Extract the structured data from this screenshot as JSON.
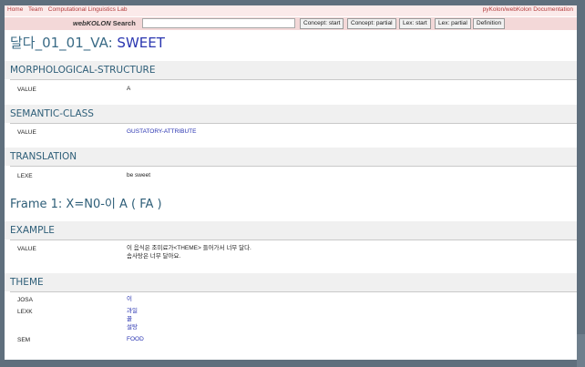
{
  "topnav": {
    "left_links": [
      "Home",
      "Team",
      "Computational Linguistics Lab"
    ],
    "right_link": "pyKolon/webKolon Documentation"
  },
  "search": {
    "label_brand": "webKOLON",
    "label_rest": "Search",
    "value": "",
    "buttons": [
      "Concept: start",
      "Concept: partial",
      "Lex: start",
      "Lex: partial",
      "Definition"
    ]
  },
  "entry": {
    "id": "달다_01_01_VA:",
    "keyword": "SWEET"
  },
  "sections": [
    {
      "title": "MORPHOLOGICAL-STRUCTURE",
      "rows": [
        {
          "key": "VALUE",
          "value": "A"
        }
      ]
    },
    {
      "title": "SEMANTIC-CLASS",
      "rows": [
        {
          "key": "VALUE",
          "value": "GUSTATORY-ATTRIBUTE"
        }
      ]
    },
    {
      "title": "TRANSLATION",
      "rows": [
        {
          "key": "LEXE",
          "value": "be sweet"
        }
      ]
    }
  ],
  "frame": {
    "title": "Frame 1: X=N0-이 A ( FA )"
  },
  "example": {
    "title": "EXAMPLE",
    "key": "VALUE",
    "lines": [
      "이 음식은 조미료가<THEME> 들어가서 너무 달다.",
      "솜사탕은 너무 달아요."
    ]
  },
  "theme": {
    "title": "THEME",
    "rows": [
      {
        "key": "JOSA",
        "values": [
          "이"
        ]
      },
      {
        "key": "LEXK",
        "values": [
          "과일",
          "꿀",
          "설탕"
        ]
      },
      {
        "key": "SEM",
        "values": [
          "FOOD"
        ]
      }
    ]
  },
  "colors": {
    "background": "#5f6f7d",
    "section_heading": "#2e5e78",
    "link": "#2732b0",
    "nav_bar": "#fbeaea",
    "search_bar": "#f3d8d8"
  }
}
